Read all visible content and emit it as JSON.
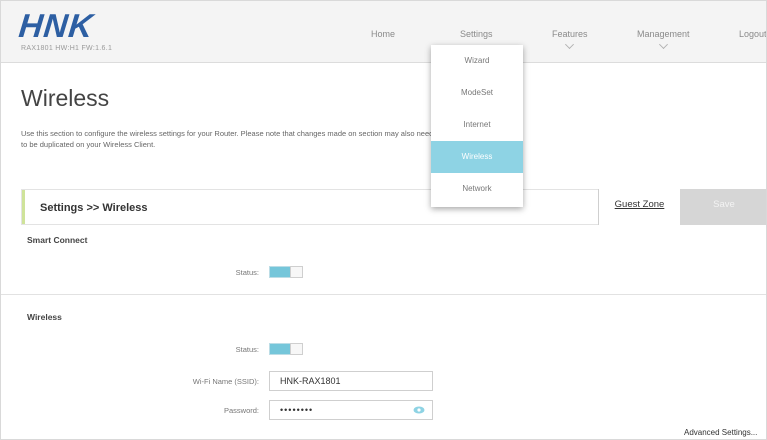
{
  "brand": {
    "logo": "HNK",
    "firmware": "RAX1801 HW:H1 FW:1.6.1",
    "logo_color": "#2d5fa3"
  },
  "nav": {
    "items": [
      {
        "label": "Home",
        "has_chevron": false
      },
      {
        "label": "Settings",
        "has_chevron": false
      },
      {
        "label": "Features",
        "has_chevron": true
      },
      {
        "label": "Management",
        "has_chevron": true
      },
      {
        "label": "Logout",
        "has_chevron": false
      }
    ]
  },
  "settings_menu": {
    "items": [
      "Wizard",
      "ModeSet",
      "Internet",
      "Wireless",
      "Network"
    ],
    "active": "Wireless",
    "active_color": "#8ed3e4"
  },
  "page": {
    "title": "Wireless",
    "intro": "Use this section to configure the wireless settings for your Router. Please note that changes made on section may also need to be duplicated on your Wireless Client."
  },
  "section_bar": {
    "title": "Settings >> Wireless",
    "guest_zone": "Guest Zone",
    "save": "Save"
  },
  "smart_connect": {
    "heading": "Smart Connect",
    "status_label": "Status:",
    "status_on": true
  },
  "wireless": {
    "heading": "Wireless",
    "status_label": "Status:",
    "status_on": true,
    "ssid_label": "Wi-Fi Name (SSID):",
    "ssid_value": "HNK-RAX1801",
    "password_label": "Password:",
    "password_value": "••••••••",
    "advanced": "Advanced Settings..."
  },
  "colors": {
    "toggle_on": "#75c6da",
    "section_accent": "#cfe39a",
    "save_disabled": "#d6d6d6"
  }
}
